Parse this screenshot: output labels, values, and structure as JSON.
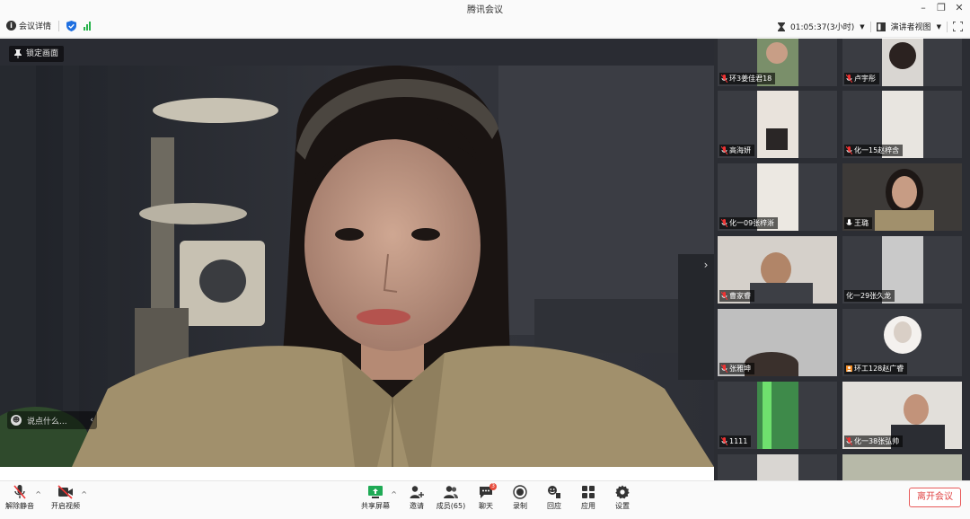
{
  "window": {
    "title": "腾讯会议"
  },
  "infobar": {
    "meeting_details": "会议详情",
    "timer": "01:05:37(3小时)",
    "view_mode": "演讲者视图"
  },
  "main": {
    "pin_label": "锁定画面",
    "chat_placeholder": "说点什么..."
  },
  "participants": [
    {
      "name": "环3姜佳君18",
      "mic": "muted"
    },
    {
      "name": "卢宇彤",
      "mic": "muted"
    },
    {
      "name": "高海妍",
      "mic": "muted"
    },
    {
      "name": "化一15赵梓含",
      "mic": "muted"
    },
    {
      "name": "化一09张梓淅",
      "mic": "muted"
    },
    {
      "name": "王璐",
      "mic": "on"
    },
    {
      "name": "曹家睿",
      "mic": "muted"
    },
    {
      "name": "化一29张久龙",
      "mic": "none"
    },
    {
      "name": "张雅坤",
      "mic": "muted"
    },
    {
      "name": "环工128赵广睿",
      "mic": "avatar"
    },
    {
      "name": "1111",
      "mic": "muted"
    },
    {
      "name": "化一38张弘帅",
      "mic": "muted"
    }
  ],
  "toolbar": {
    "unmute": "解除静音",
    "start_video": "开启视频",
    "share_screen": "共享屏幕",
    "invite": "邀请",
    "members": "成员(65)",
    "chat": "聊天",
    "chat_badge": "3",
    "record": "录制",
    "reactions": "回应",
    "apps": "应用",
    "settings": "设置",
    "leave": "离开会议"
  }
}
